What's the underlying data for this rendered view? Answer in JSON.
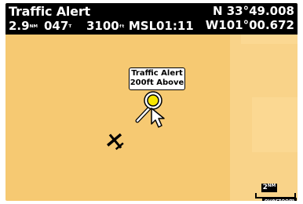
{
  "header": {
    "title": "Traffic Alert",
    "distance": "2.9",
    "distance_unit": "ᴺᴹ",
    "track": "047",
    "track_unit": "ᵀ",
    "altitude": "3100",
    "altitude_unit": "ᶠᵗ",
    "altitude_ref": "MSL",
    "time": "01:11",
    "latitude": "N  33°49.008",
    "longitude": "W101°00.672"
  },
  "alert_popup": {
    "line1": "Traffic Alert",
    "line2": "200ft Above"
  },
  "map": {
    "base_color": "#f6c972",
    "highlight_color": "#f9d389",
    "target_color": "#f7e600",
    "icons": [
      "traffic-target-icon",
      "cursor-arrow-icon",
      "aircraft-icon"
    ]
  },
  "scale": {
    "value": "2ᴺᴹ",
    "mode": "overzoom"
  }
}
